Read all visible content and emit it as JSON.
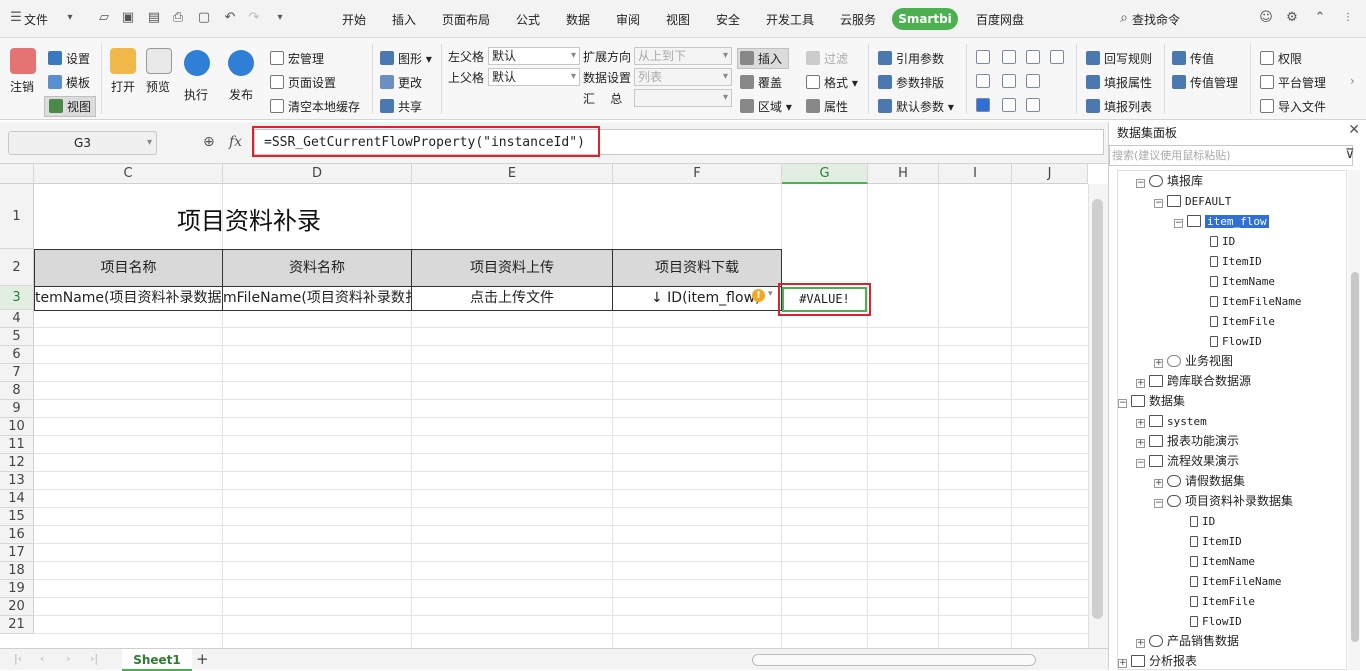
{
  "menubar": {
    "file": "文件",
    "tabs": [
      "开始",
      "插入",
      "页面布局",
      "公式",
      "数据",
      "审阅",
      "视图",
      "安全",
      "开发工具",
      "云服务"
    ],
    "active_tab": "Smartbi",
    "tab_after": "百度网盘",
    "search": "查找命令"
  },
  "ribbon": {
    "logout": "注销",
    "settings": "设置",
    "template": "模板",
    "view": "视图",
    "open": "打开",
    "preview": "预览",
    "execute": "执行",
    "publish": "发布",
    "macro": "宏管理",
    "page_setup": "页面设置",
    "clear_cache": "清空本地缓存",
    "shape": "图形",
    "change": "更改",
    "share": "共享",
    "left_parent": "左父格",
    "top_parent": "上父格",
    "left_parent_value": "默认",
    "top_parent_value": "默认",
    "expand_dir": "扩展方向",
    "expand_dir_value": "从上到下",
    "data_setting": "数据设置",
    "data_setting_value": "列表",
    "summary": "汇    总",
    "insert": "插入",
    "overwrite": "覆盖",
    "area": "区域",
    "filter": "过滤",
    "format": "格式",
    "attribute": "属性",
    "ref_param": "引用参数",
    "param_layout": "参数排版",
    "default_param": "默认参数",
    "writeback": "回写规则",
    "fill_attr": "填报属性",
    "fill_list": "填报列表",
    "pass_value": "传值",
    "pass_value_mgmt": "传值管理",
    "permission": "权限",
    "platform_mgmt": "平台管理",
    "import_file": "导入文件"
  },
  "formula_bar": {
    "name_box": "G3",
    "fx": "fx",
    "formula": "=SSR_GetCurrentFlowProperty(\"instanceId\")"
  },
  "sheet": {
    "columns": [
      "C",
      "D",
      "E",
      "F",
      "G",
      "H",
      "I",
      "J"
    ],
    "rows": [
      "1",
      "2",
      "3",
      "4",
      "5",
      "6",
      "7",
      "8",
      "9",
      "10",
      "11",
      "12",
      "13",
      "14",
      "15",
      "16",
      "17",
      "18",
      "19",
      "20",
      "21"
    ],
    "title": "项目资料补录",
    "headers": [
      "项目名称",
      "资料名称",
      "项目资料上传",
      "项目资料下载"
    ],
    "row3": [
      "temName(项目资料补录数据",
      "mFileName(项目资料补录数扌",
      "点击上传文件",
      "↓ ID(item_flow)",
      "#VALUE!"
    ],
    "tab": "Sheet1"
  },
  "panel": {
    "title": "数据集面板",
    "search_placeholder": "搜索(建议使用鼠标粘贴)",
    "tree": {
      "fill_db": "填报库",
      "default": "DEFAULT",
      "item_flow": "item_flow",
      "fields": [
        "ID",
        "ItemID",
        "ItemName",
        "ItemFileName",
        "ItemFile",
        "FlowID"
      ],
      "biz_view": "业务视图",
      "cross_db": "跨库联合数据源",
      "datasets": "数据集",
      "system": "system",
      "report_demo": "报表功能演示",
      "flow_demo": "流程效果演示",
      "leave_ds": "请假数据集",
      "item_ds": "项目资料补录数据集",
      "ds_fields": [
        "ID",
        "ItemID",
        "ItemName",
        "ItemFileName",
        "ItemFile",
        "FlowID"
      ],
      "sales": "产品销售数据",
      "analysis": "分析报表"
    }
  }
}
